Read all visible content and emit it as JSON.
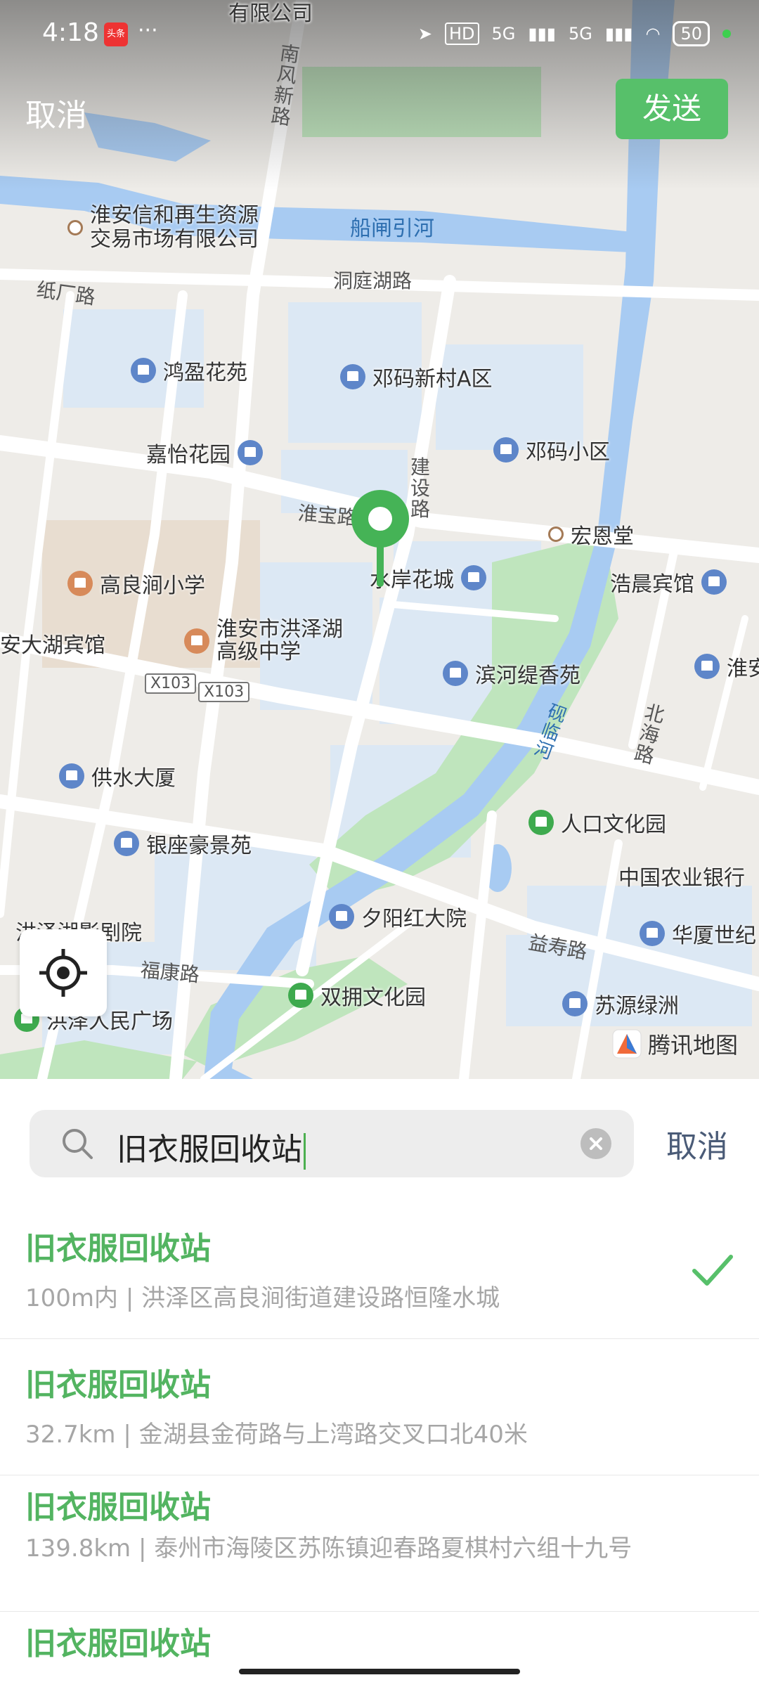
{
  "status": {
    "time": "4:18",
    "app_badge": "头条",
    "dots": "···",
    "hd": "HD",
    "net1": "5G",
    "net2": "5G",
    "battery": "50"
  },
  "header": {
    "cancel_label": "取消",
    "send_label": "发送"
  },
  "map": {
    "labels": {
      "company_top": "有限公司",
      "recycle_market": "淮安信和再生资源\n交易市场有限公司",
      "honying": "鸿盈花苑",
      "dengma_a": "邓码新村A区",
      "jiayi": "嘉怡花园",
      "dengma": "邓码小区",
      "honggen": "宏恩堂",
      "shuian": "水岸花城",
      "haochen": "浩晨宾馆",
      "gaoliang": "高良涧小学",
      "hongze_school": "淮安市洪泽湖\n高级中学",
      "dahu_hotel": "安大湖宾馆",
      "binhe": "滨河缇香苑",
      "huai": "淮安",
      "gongshui": "供水大厦",
      "renkou": "人口文化园",
      "yinzuo": "银座豪景苑",
      "nongye": "中国农业银行",
      "xiyang": "夕阳红大院",
      "huaxia": "华厦世纪",
      "theater": "洪泽湖影剧院",
      "shuangyong": "双拥文化园",
      "suyuan": "苏源绿洲",
      "square": "洪泽人民广场"
    },
    "roads": {
      "nanfeng": "南\n风\n新\n路",
      "dongting": "洞庭湖路",
      "zhichang": "纸厂路",
      "jianshe": "建\n设\n路",
      "huaibao": "淮宝路",
      "x103a": "X103",
      "x103b": "X103",
      "beihai": "北\n海\n路",
      "yishou": "益寿路",
      "fukang": "福康路"
    },
    "water": {
      "chuanzha": "船闸引河",
      "yanlin": "砚\n临\n河"
    },
    "logo": "腾讯地图"
  },
  "search": {
    "query": "旧衣服回收站",
    "cancel_label": "取消"
  },
  "results": [
    {
      "title": "旧衣服回收站",
      "subtitle": "100m内 | 洪泽区高良涧街道建设路恒隆水城",
      "selected": true
    },
    {
      "title": "旧衣服回收站",
      "subtitle": "32.7km | 金湖县金荷路与上湾路交叉口北40米",
      "selected": false
    },
    {
      "title": "旧衣服回收站",
      "subtitle": "139.8km | 泰州市海陵区苏陈镇迎春路夏棋村六组十九号",
      "selected": false
    },
    {
      "title": "旧衣服回收站",
      "subtitle": "",
      "selected": false
    }
  ],
  "colors": {
    "accent": "#57c06a",
    "water": "#a8cbf2",
    "park": "#bfe5bd",
    "block": "#dce8f4"
  }
}
